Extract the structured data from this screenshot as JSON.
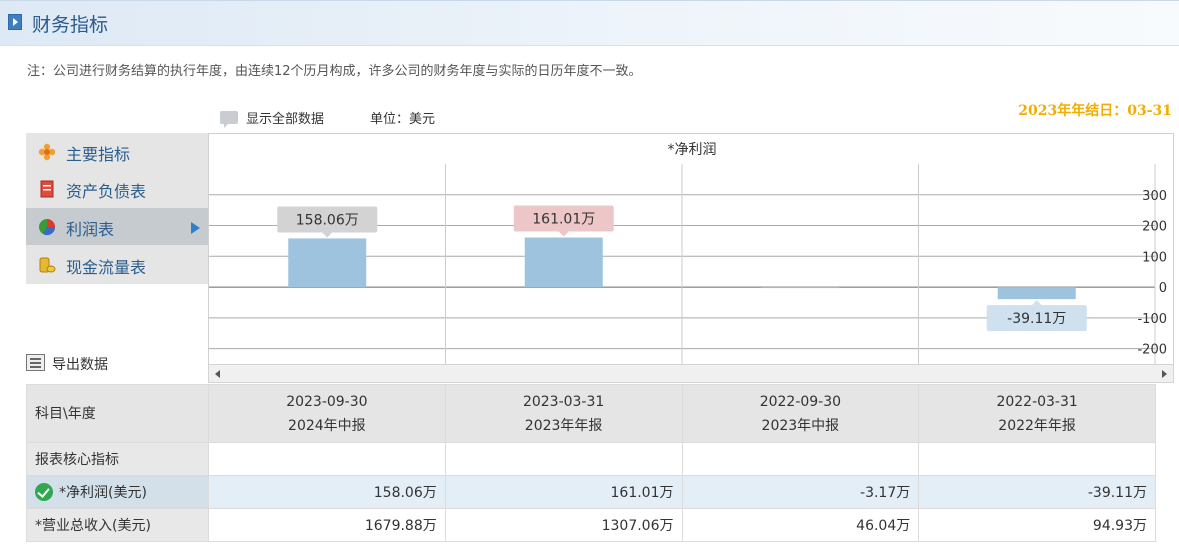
{
  "header": {
    "title": "财务指标"
  },
  "note": "注：公司进行财务结算的执行年度，由连续12个历月构成，许多公司的财务年度与实际的日历年度不一致。",
  "toolbar": {
    "show_all_label": "显示全部数据",
    "unit_label": "单位：美元"
  },
  "year_end": "2023年年结日：03-31",
  "sidebar": {
    "items": [
      {
        "label": "主要指标",
        "icon": "flower-icon"
      },
      {
        "label": "资产负债表",
        "icon": "document-icon"
      },
      {
        "label": "利润表",
        "icon": "pie-chart-icon",
        "active": true
      },
      {
        "label": "现金流量表",
        "icon": "coins-icon"
      }
    ]
  },
  "export": {
    "label": "导出数据"
  },
  "chart_data": {
    "type": "bar",
    "title": "*净利润",
    "categories": [
      "2023-09-30",
      "2023-03-31",
      "2022-09-30",
      "2022-03-31"
    ],
    "values": [
      158.06,
      161.01,
      -3.17,
      -39.11
    ],
    "data_labels": [
      "158.06万",
      "161.01万",
      "",
      "-39.11万"
    ],
    "yticks": [
      300,
      200,
      100,
      0,
      -100,
      -200
    ],
    "ylim": [
      -250,
      400
    ],
    "bar_color": "#9dc3df",
    "label_colors": [
      "#d3d3d3",
      "#edc7c7",
      "#d3d3d3",
      "#cfe0ee"
    ]
  },
  "table": {
    "header_label": "科目\\年度",
    "columns": [
      {
        "date": "2023-09-30",
        "report": "2024年中报"
      },
      {
        "date": "2023-03-31",
        "report": "2023年年报"
      },
      {
        "date": "2022-09-30",
        "report": "2023年中报"
      },
      {
        "date": "2022-03-31",
        "report": "2022年年报"
      }
    ],
    "section": "报表核心指标",
    "rows": [
      {
        "label": "*净利润(美元)",
        "values": [
          "158.06万",
          "161.01万",
          "-3.17万",
          "-39.11万"
        ]
      },
      {
        "label": "*营业总收入(美元)",
        "values": [
          "1679.88万",
          "1307.06万",
          "46.04万",
          "94.93万"
        ]
      }
    ]
  }
}
